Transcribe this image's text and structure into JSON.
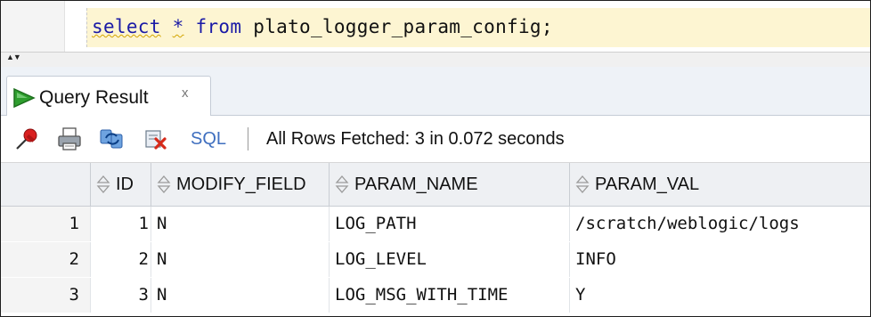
{
  "editor": {
    "sql_keyword_select": "select",
    "sql_star": "*",
    "sql_keyword_from": "from",
    "sql_rest": "plato_logger_param_config;"
  },
  "tab": {
    "label": "Query Result",
    "close": "x",
    "icon": "play-triangle-icon"
  },
  "toolbar": {
    "icons": [
      "pin-icon",
      "print-icon",
      "refresh-icon",
      "export-icon"
    ],
    "sql_label": "SQL",
    "separator": "|",
    "status": "All Rows Fetched: 3 in 0.072 seconds"
  },
  "table": {
    "columns": [
      "ID",
      "MODIFY_FIELD",
      "PARAM_NAME",
      "PARAM_VAL"
    ],
    "rows": [
      {
        "num": "1",
        "id": "1",
        "modify": "N",
        "name": "LOG_PATH",
        "val": "/scratch/weblogic/logs"
      },
      {
        "num": "2",
        "id": "2",
        "modify": "N",
        "name": "LOG_LEVEL",
        "val": "INFO"
      },
      {
        "num": "3",
        "id": "3",
        "modify": "N",
        "name": "LOG_MSG_WITH_TIME",
        "val": "Y"
      }
    ]
  },
  "colors": {
    "keyword": "#1a1aa6",
    "current_line": "#fdf5d2",
    "sql_link": "#3f6fbf",
    "play_green": "#2e9e2e"
  }
}
